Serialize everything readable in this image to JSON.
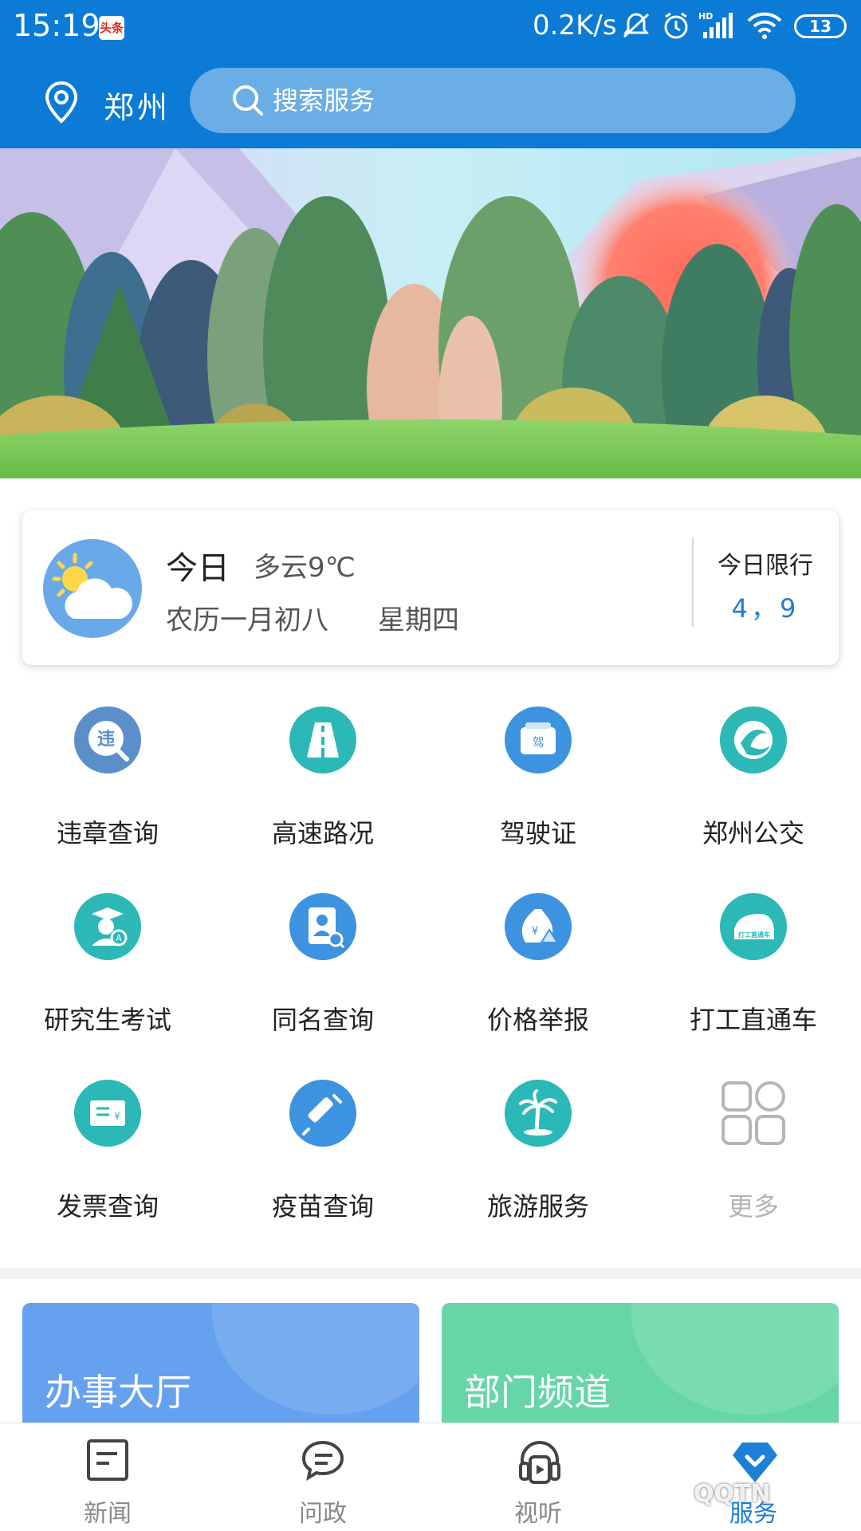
{
  "status_bar": {
    "time": "15:19",
    "news_badge": "头条",
    "network_speed": "0.2K/s",
    "battery": "13",
    "icons": [
      "news-icon",
      "mute-icon",
      "alarm-icon",
      "hd-signal-icon",
      "wifi-icon",
      "battery-icon"
    ]
  },
  "header": {
    "city": "郑州",
    "search_placeholder": "搜索服务",
    "colors": {
      "header_bg": "#0b7bd5",
      "search_bg": "#6aaee5"
    }
  },
  "weather": {
    "today_label": "今日",
    "condition": "多云9℃",
    "lunar_date": "农历一月初八",
    "weekday": "星期四",
    "limit_label": "今日限行",
    "limit_value": "4，9"
  },
  "services": [
    {
      "label": "违章查询",
      "icon": "violation-icon",
      "color": "#5b8fc9"
    },
    {
      "label": "高速路况",
      "icon": "highway-icon",
      "color": "#2bb8b7"
    },
    {
      "label": "驾驶证",
      "icon": "license-icon",
      "color": "#3d93e0"
    },
    {
      "label": "郑州公交",
      "icon": "bus-icon",
      "color": "#2bb8b7"
    },
    {
      "label": "研究生考试",
      "icon": "graduate-icon",
      "color": "#2bb8b7"
    },
    {
      "label": "同名查询",
      "icon": "name-search-icon",
      "color": "#3d93e0"
    },
    {
      "label": "价格举报",
      "icon": "price-report-icon",
      "color": "#3d93e0"
    },
    {
      "label": "打工直通车",
      "icon": "train-icon",
      "color": "#2bb8b7"
    },
    {
      "label": "发票查询",
      "icon": "invoice-icon",
      "color": "#2bb8b7"
    },
    {
      "label": "疫苗查询",
      "icon": "vaccine-icon",
      "color": "#3d93e0"
    },
    {
      "label": "旅游服务",
      "icon": "travel-icon",
      "color": "#2bb8b7"
    },
    {
      "label": "更多",
      "icon": "more-grid-icon",
      "color": "#b5b5b5"
    }
  ],
  "cards": [
    {
      "label": "办事大厅",
      "color": "#66a1ef"
    },
    {
      "label": "部门频道",
      "color": "#66d6a8"
    }
  ],
  "tabs": [
    {
      "label": "新闻",
      "icon": "news-tab-icon"
    },
    {
      "label": "问政",
      "icon": "chat-tab-icon"
    },
    {
      "label": "视听",
      "icon": "media-tab-icon"
    },
    {
      "label": "服务",
      "icon": "service-tab-icon",
      "active": true
    }
  ],
  "watermark": "QQTN"
}
